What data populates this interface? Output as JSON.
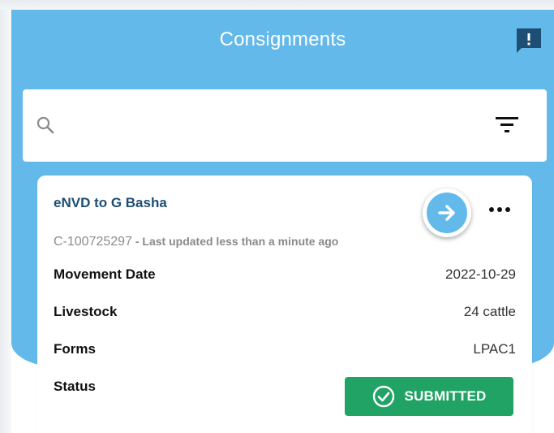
{
  "header": {
    "title": "Consignments",
    "feedback_icon": "feedback-alert-icon"
  },
  "search": {
    "placeholder": "",
    "value": "",
    "search_icon": "search-icon",
    "filter_icon": "filter-icon"
  },
  "consignment": {
    "title": "eNVD to G Basha",
    "id": "C-100725297",
    "separator": " - ",
    "updated": "Last updated less than a minute ago",
    "rows": [
      {
        "label": "Movement Date",
        "value": "2022-10-29"
      },
      {
        "label": "Livestock",
        "value": "24 cattle"
      },
      {
        "label": "Forms",
        "value": "LPAC1"
      }
    ],
    "status_label": "Status",
    "status_value": "SUBMITTED",
    "go_icon": "arrow-right-icon",
    "more_icon": "more-horizontal-icon"
  },
  "colors": {
    "header_blue": "#62b9ea",
    "title_navy": "#1e4e73",
    "status_green": "#21a366"
  }
}
